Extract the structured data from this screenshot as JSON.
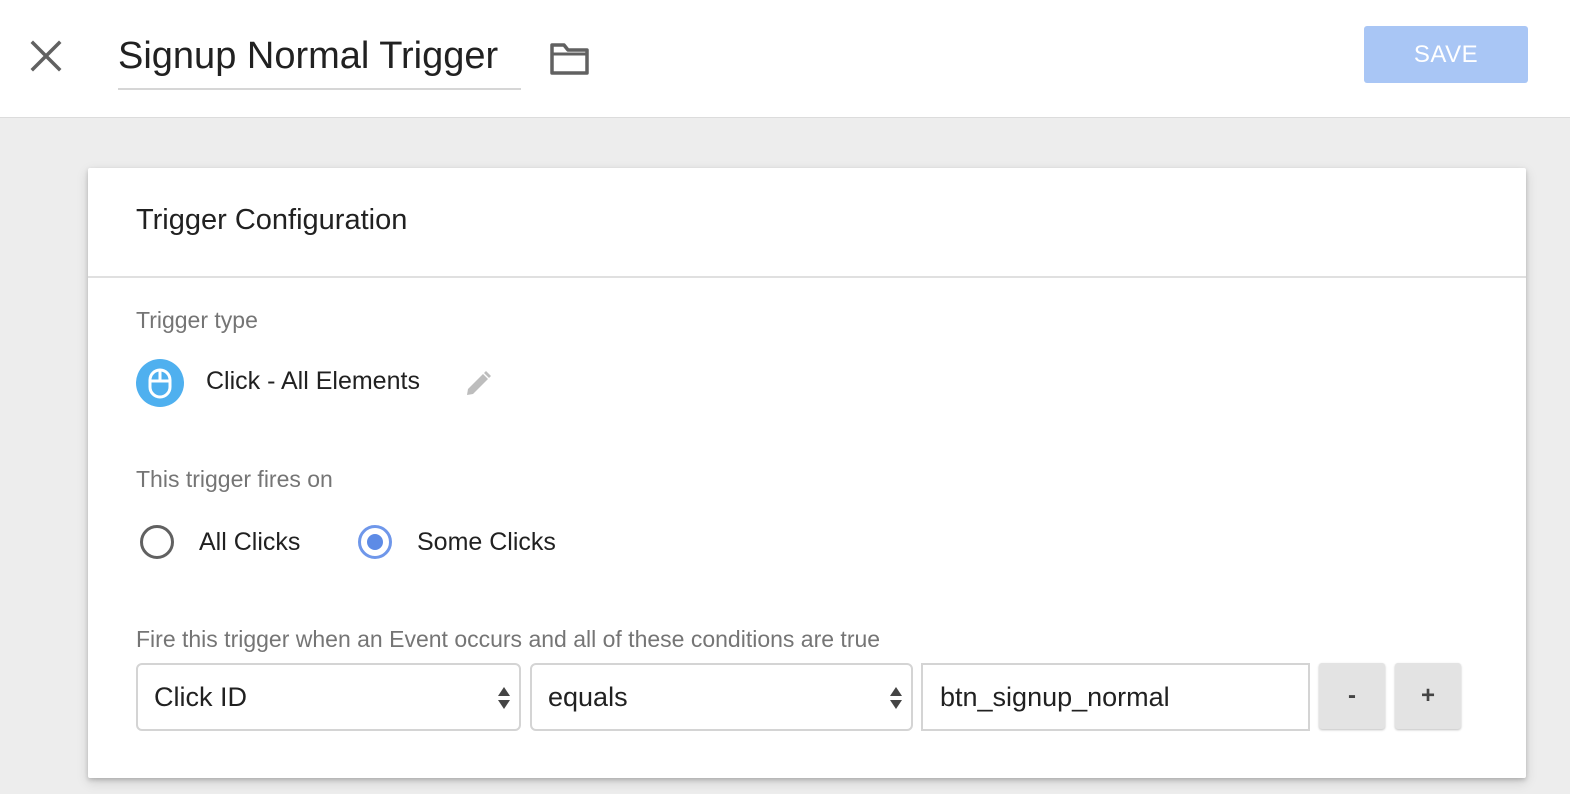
{
  "header": {
    "title": "Signup Normal Trigger",
    "save_label": "SAVE",
    "save_color": "#a9c6f5"
  },
  "card": {
    "title": "Trigger Configuration",
    "trigger_type_label": "Trigger type",
    "trigger_type_name": "Click - All Elements",
    "trigger_icon_color": "#4fb0ef",
    "fires_on_label": "This trigger fires on",
    "radio_options": [
      {
        "label": "All Clicks",
        "checked": false
      },
      {
        "label": "Some Clicks",
        "checked": true
      }
    ],
    "conditions_label": "Fire this trigger when an Event occurs and all of these conditions are true",
    "condition": {
      "variable": "Click ID",
      "operator": "equals",
      "value": "btn_signup_normal"
    },
    "remove_label": "-",
    "add_label": "+"
  },
  "icons": {
    "close": "close-icon",
    "folder": "folder-icon",
    "mouse": "mouse-icon",
    "edit": "pencil-icon"
  }
}
